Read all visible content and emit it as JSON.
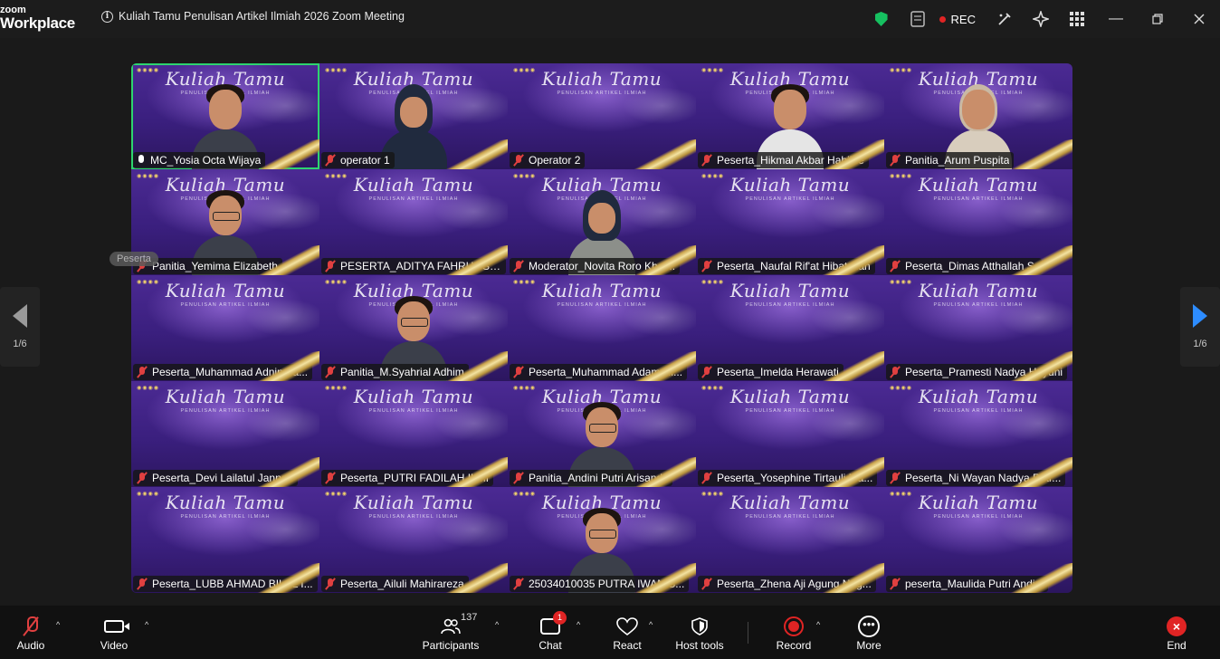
{
  "app": {
    "logo_line1": "zoom",
    "logo_line2": "Workplace"
  },
  "meeting": {
    "title": "Kuliah Tamu Penulisan Artikel Ilmiah 2026 Zoom Meeting"
  },
  "recording": {
    "label": "REC"
  },
  "banner": {
    "title": "Kuliah Tamu",
    "subtitle": "PENULISAN ARTIKEL ILMIAH"
  },
  "pagination": {
    "left": "1/6",
    "right": "1/6"
  },
  "tooltip": "Peserta",
  "participants": [
    {
      "name": "MC_Yosia Octa Wijaya",
      "muted": false,
      "active": true,
      "video": "person"
    },
    {
      "name": "operator 1",
      "muted": true,
      "video": "hijab"
    },
    {
      "name": "Operator 2",
      "muted": true,
      "video": ""
    },
    {
      "name": "Peserta_Hikmal Akbar Habibie",
      "muted": true,
      "video": "white"
    },
    {
      "name": "Panitia_Arum Puspita",
      "muted": true,
      "video": "light"
    },
    {
      "name": "Panitia_Yemima Elizabeth",
      "muted": true,
      "video": "glasses"
    },
    {
      "name": "PESERTA_ADITYA FAHRUL SAP...",
      "muted": true,
      "video": ""
    },
    {
      "name": "Moderator_Novita Roro Khoi...",
      "muted": true,
      "video": "hijab-grey"
    },
    {
      "name": "Peserta_Naufal Rif'at Hibatullah",
      "muted": true,
      "video": ""
    },
    {
      "name": "Peserta_Dimas Atthallah S.",
      "muted": true,
      "video": ""
    },
    {
      "name": "Peserta_Muhammad Adnin Fa...",
      "muted": true,
      "video": ""
    },
    {
      "name": "Panitia_M.Syahrial Adhim",
      "muted": true,
      "video": "glasses"
    },
    {
      "name": "Peserta_Muhammad Adam Hi...",
      "muted": true,
      "video": ""
    },
    {
      "name": "Peserta_Imelda Herawati",
      "muted": true,
      "video": ""
    },
    {
      "name": "Peserta_Pramesti Nadya Hayuni",
      "muted": true,
      "video": ""
    },
    {
      "name": "Peserta_Devi Lailatul Jannah",
      "muted": true,
      "video": ""
    },
    {
      "name": "Peserta_PUTRI FADILAH ILMI",
      "muted": true,
      "video": ""
    },
    {
      "name": "Panitia_Andini Putri Arisandy",
      "muted": true,
      "video": "glasses"
    },
    {
      "name": "Peserta_Yosephine Tirtauli Ma...",
      "muted": true,
      "video": ""
    },
    {
      "name": "Peserta_Ni Wayan Nadya Putr...",
      "muted": true,
      "video": ""
    },
    {
      "name": "Peserta_LUBB AHMAD BILAL I...",
      "muted": true,
      "video": ""
    },
    {
      "name": "Peserta_Ailuli Mahirareza",
      "muted": true,
      "video": ""
    },
    {
      "name": "25034010035 PUTRA IWAN S...",
      "muted": true,
      "video": "glasses"
    },
    {
      "name": "Peserta_Zhena Aji Agung Nug...",
      "muted": true,
      "video": ""
    },
    {
      "name": "peserta_Maulida Putri Andini",
      "muted": true,
      "video": ""
    }
  ],
  "toolbar": {
    "audio": "Audio",
    "video": "Video",
    "participants": "Participants",
    "participants_count": "137",
    "chat": "Chat",
    "chat_badge": "1",
    "react": "React",
    "host_tools": "Host tools",
    "record": "Record",
    "more": "More",
    "end": "End"
  },
  "colors": {
    "active_speaker": "#2ed46f",
    "recording": "#e02424",
    "accent": "#2d8cff",
    "security": "#16c060"
  }
}
